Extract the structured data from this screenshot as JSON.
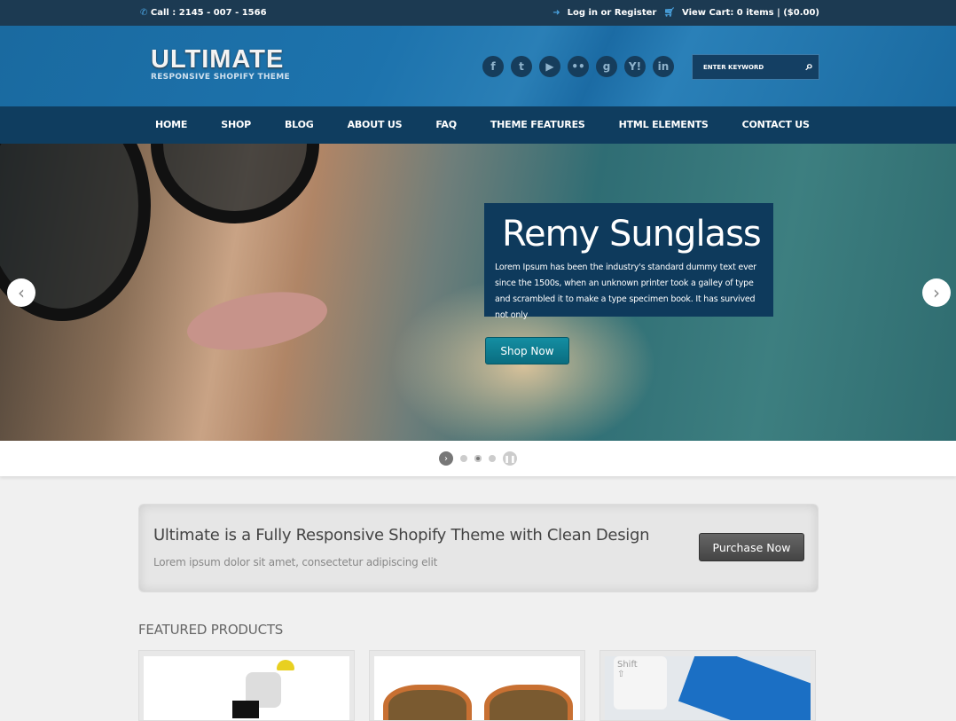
{
  "topbar": {
    "phone": "Call : 2145 - 007 - 1566",
    "login": "Log in",
    "or": "or",
    "register": "Register",
    "cart": "View Cart: 0 items | ($0.00)"
  },
  "header": {
    "logo_title": "ULTIMATE",
    "logo_subtitle": "RESPONSIVE SHOPIFY THEME",
    "social": [
      {
        "icon": "facebook-icon",
        "glyph": "f"
      },
      {
        "icon": "twitter-icon",
        "glyph": "t"
      },
      {
        "icon": "youtube-icon",
        "glyph": "▶"
      },
      {
        "icon": "flickr-icon",
        "glyph": "••"
      },
      {
        "icon": "google-icon",
        "glyph": "g"
      },
      {
        "icon": "yahoo-icon",
        "glyph": "Y!"
      },
      {
        "icon": "linkedin-icon",
        "glyph": "in"
      }
    ],
    "search_placeholder": "ENTER KEYWORD"
  },
  "nav": [
    "HOME",
    "SHOP",
    "BLOG",
    "ABOUT US",
    "FAQ",
    "THEME FEATURES",
    "HTML ELEMENTS",
    "CONTACT US"
  ],
  "slider": {
    "title": "Remy Sunglass",
    "text": "Lorem Ipsum has been the industry's standard dummy text ever since the 1500s, when an unknown printer took a galley of type and scrambled it to make a type specimen book. It has survived not only",
    "button": "Shop Now",
    "slides": 3,
    "active_slide": 2
  },
  "promo": {
    "title": "Ultimate is a Fully Responsive Shopify Theme with Clean Design",
    "subtitle": "Lorem ipsum dolor sit amet, consectetur adipiscing elit",
    "button": "Purchase Now"
  },
  "featured": {
    "heading": "FEATURED PRODUCTS"
  },
  "colors": {
    "topbar": "#1c3a52",
    "header": "#1a6aa0",
    "nav": "#0f3d5f",
    "caption": "#0e3a5c",
    "shop_button": "#0f7f93"
  }
}
